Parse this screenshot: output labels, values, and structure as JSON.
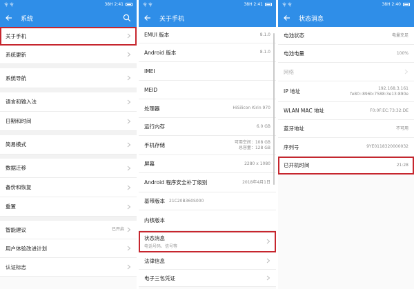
{
  "status": {
    "left": "令 令",
    "p1_time": "38H 2:41",
    "p2_time": "38H 2:41",
    "p3_time": "38H 2:40"
  },
  "panel1": {
    "title": "系统",
    "items": [
      {
        "label": "关于手机",
        "value": ""
      },
      {
        "label": "系统更新",
        "value": ""
      },
      {
        "label": "系统导航",
        "value": ""
      },
      {
        "label": "语言和输入法",
        "value": ""
      },
      {
        "label": "日期和时间",
        "value": ""
      },
      {
        "label": "简易模式",
        "value": ""
      },
      {
        "label": "数据迁移",
        "value": ""
      },
      {
        "label": "备份和恢复",
        "value": ""
      },
      {
        "label": "重置",
        "value": ""
      },
      {
        "label": "智能建议",
        "value": "已开启"
      },
      {
        "label": "用户体验改进计划",
        "value": ""
      },
      {
        "label": "认证标志",
        "value": ""
      }
    ]
  },
  "panel2": {
    "title": "关于手机",
    "items": [
      {
        "label": "EMUI 版本",
        "value": "8.1.0"
      },
      {
        "label": "Android 版本",
        "value": "8.1.0"
      },
      {
        "label": "IMEI",
        "value": ""
      },
      {
        "label": "MEID",
        "value": ""
      },
      {
        "label": "处理器",
        "value": "HiSilicon Kirin 970"
      },
      {
        "label": "运行内存",
        "value": "6.0 GB"
      },
      {
        "label": "手机存储",
        "value": "可用空间：108 GB",
        "value2": "总容量：128 GB"
      },
      {
        "label": "屏幕",
        "value": "2280 x 1080"
      },
      {
        "label": "Android 程序安全补丁级别",
        "value": "2018年4月1日"
      },
      {
        "label": "基带版本",
        "value": "21C20B360S000"
      },
      {
        "label": "内核版本",
        "value": ""
      },
      {
        "label": "状态消息",
        "sub": "电话号码、信号等"
      },
      {
        "label": "法律信息",
        "value": ""
      },
      {
        "label": "电子三包凭证",
        "value": ""
      }
    ]
  },
  "panel3": {
    "title": "状态消息",
    "items": [
      {
        "label": "电池状态",
        "value": "电量充足"
      },
      {
        "label": "电池电量",
        "value": "100%"
      },
      {
        "label": "网络",
        "value": ""
      },
      {
        "label": "IP 地址",
        "value": "192.168.3.161",
        "value2": "fe80::896b:7588:3e13:890e"
      },
      {
        "label": "WLAN MAC 地址",
        "value": "F0:0F:EC:73:32:DE"
      },
      {
        "label": "蓝牙地址",
        "value": "不可用"
      },
      {
        "label": "序列号",
        "value": "9YE0118320000032"
      },
      {
        "label": "已开机时间",
        "value": "21:28"
      }
    ]
  },
  "colors": {
    "accent": "#2f8ee8",
    "highlight": "#c6262e"
  }
}
